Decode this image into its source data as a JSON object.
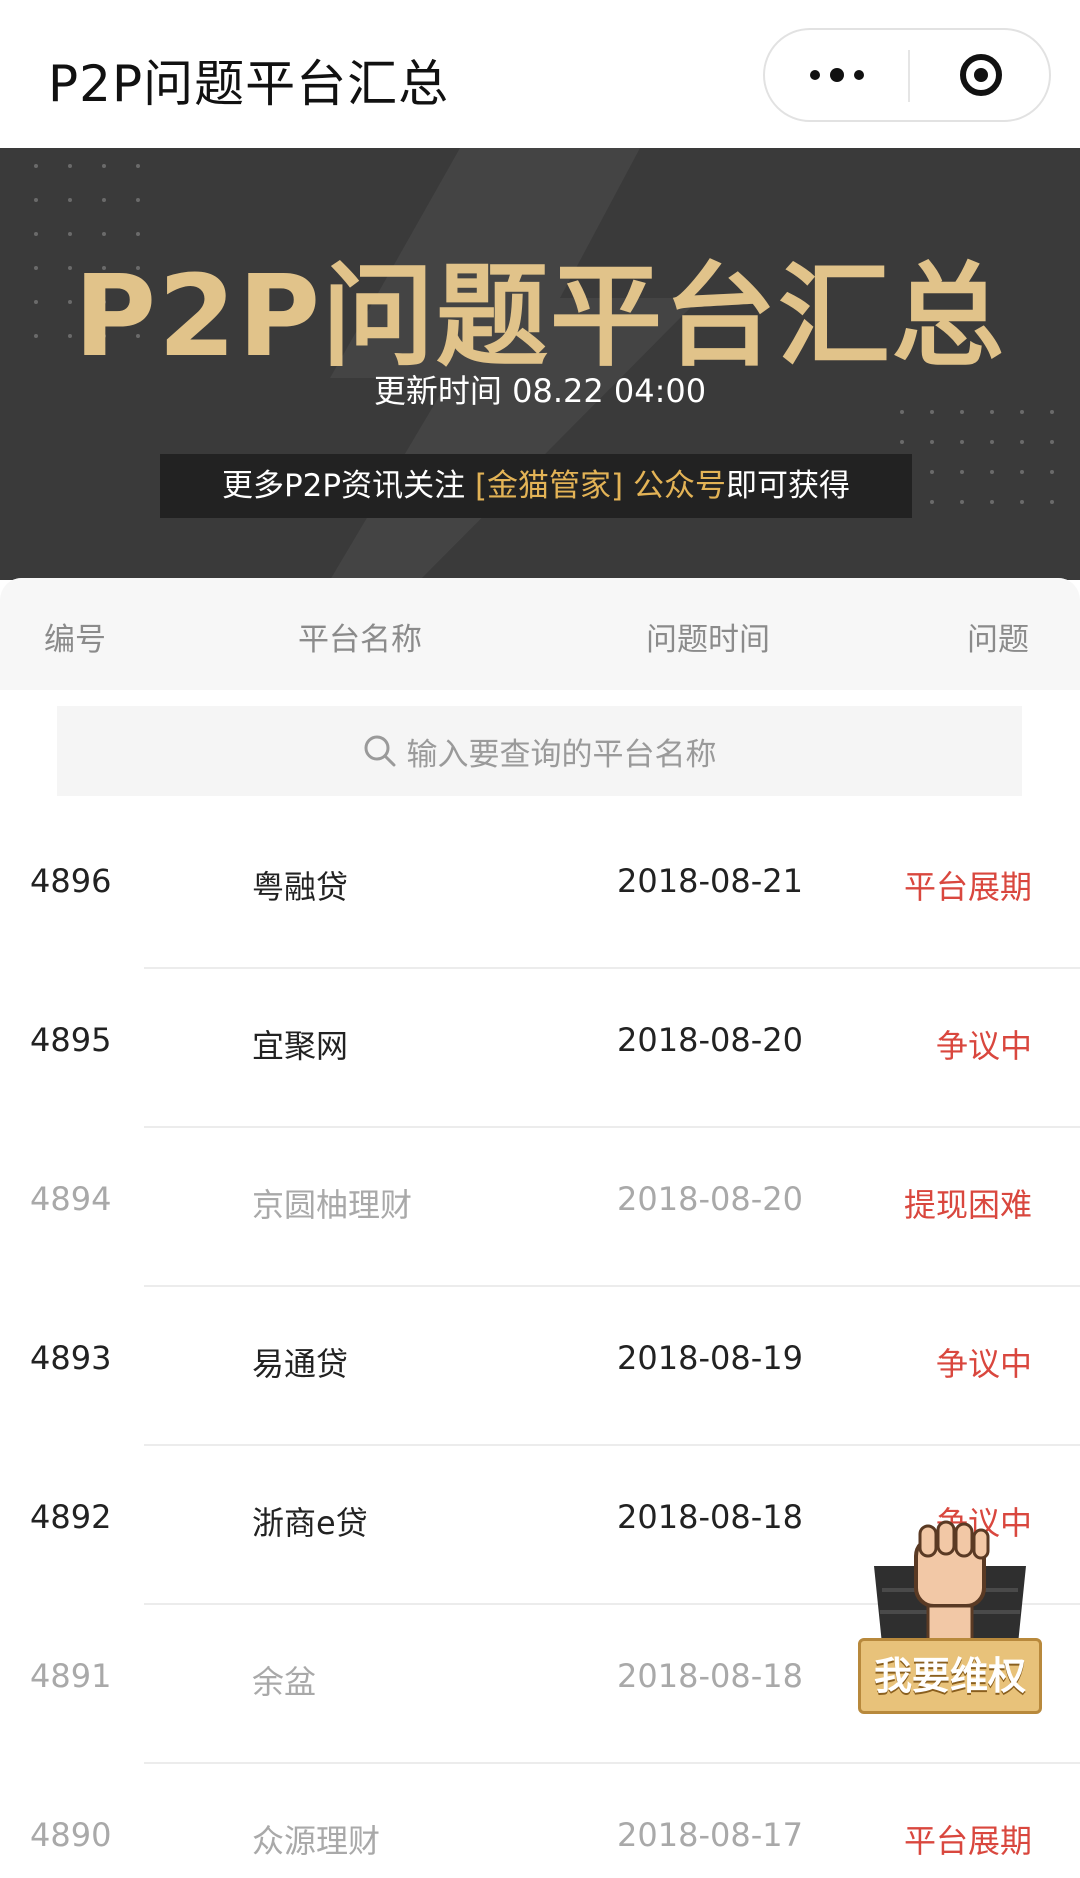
{
  "nav": {
    "title": "P2P问题平台汇总"
  },
  "banner": {
    "title": "P2P问题平台汇总",
    "update_label": "更新时间",
    "update_time": "08.22 04:00",
    "promo_prefix": "更多P2P资讯关注 ",
    "promo_highlight": "[金猫管家] 公众号",
    "promo_suffix": "即可获得",
    "accent": "#e1c38a"
  },
  "table": {
    "headers": [
      "编号",
      "平台名称",
      "问题时间",
      "问题"
    ],
    "search_placeholder": "输入要查询的平台名称",
    "issue_color": "#d9473e",
    "rows": [
      {
        "id": "4896",
        "name": "粤融贷",
        "date": "2018-08-21",
        "issue": "平台展期",
        "active": true
      },
      {
        "id": "4895",
        "name": "宜聚网",
        "date": "2018-08-20",
        "issue": "争议中",
        "active": true
      },
      {
        "id": "4894",
        "name": "京圆柚理财",
        "date": "2018-08-20",
        "issue": "提现困难",
        "active": false
      },
      {
        "id": "4893",
        "name": "易通贷",
        "date": "2018-08-19",
        "issue": "争议中",
        "active": true
      },
      {
        "id": "4892",
        "name": "浙商e贷",
        "date": "2018-08-18",
        "issue": "争议中",
        "active": true
      },
      {
        "id": "4891",
        "name": "余盆",
        "date": "2018-08-18",
        "issue": "",
        "active": false
      },
      {
        "id": "4890",
        "name": "众源理财",
        "date": "2018-08-17",
        "issue": "平台展期",
        "active": false
      }
    ]
  },
  "fab": {
    "label": "我要维权",
    "icon": "raised-fist-icon"
  }
}
